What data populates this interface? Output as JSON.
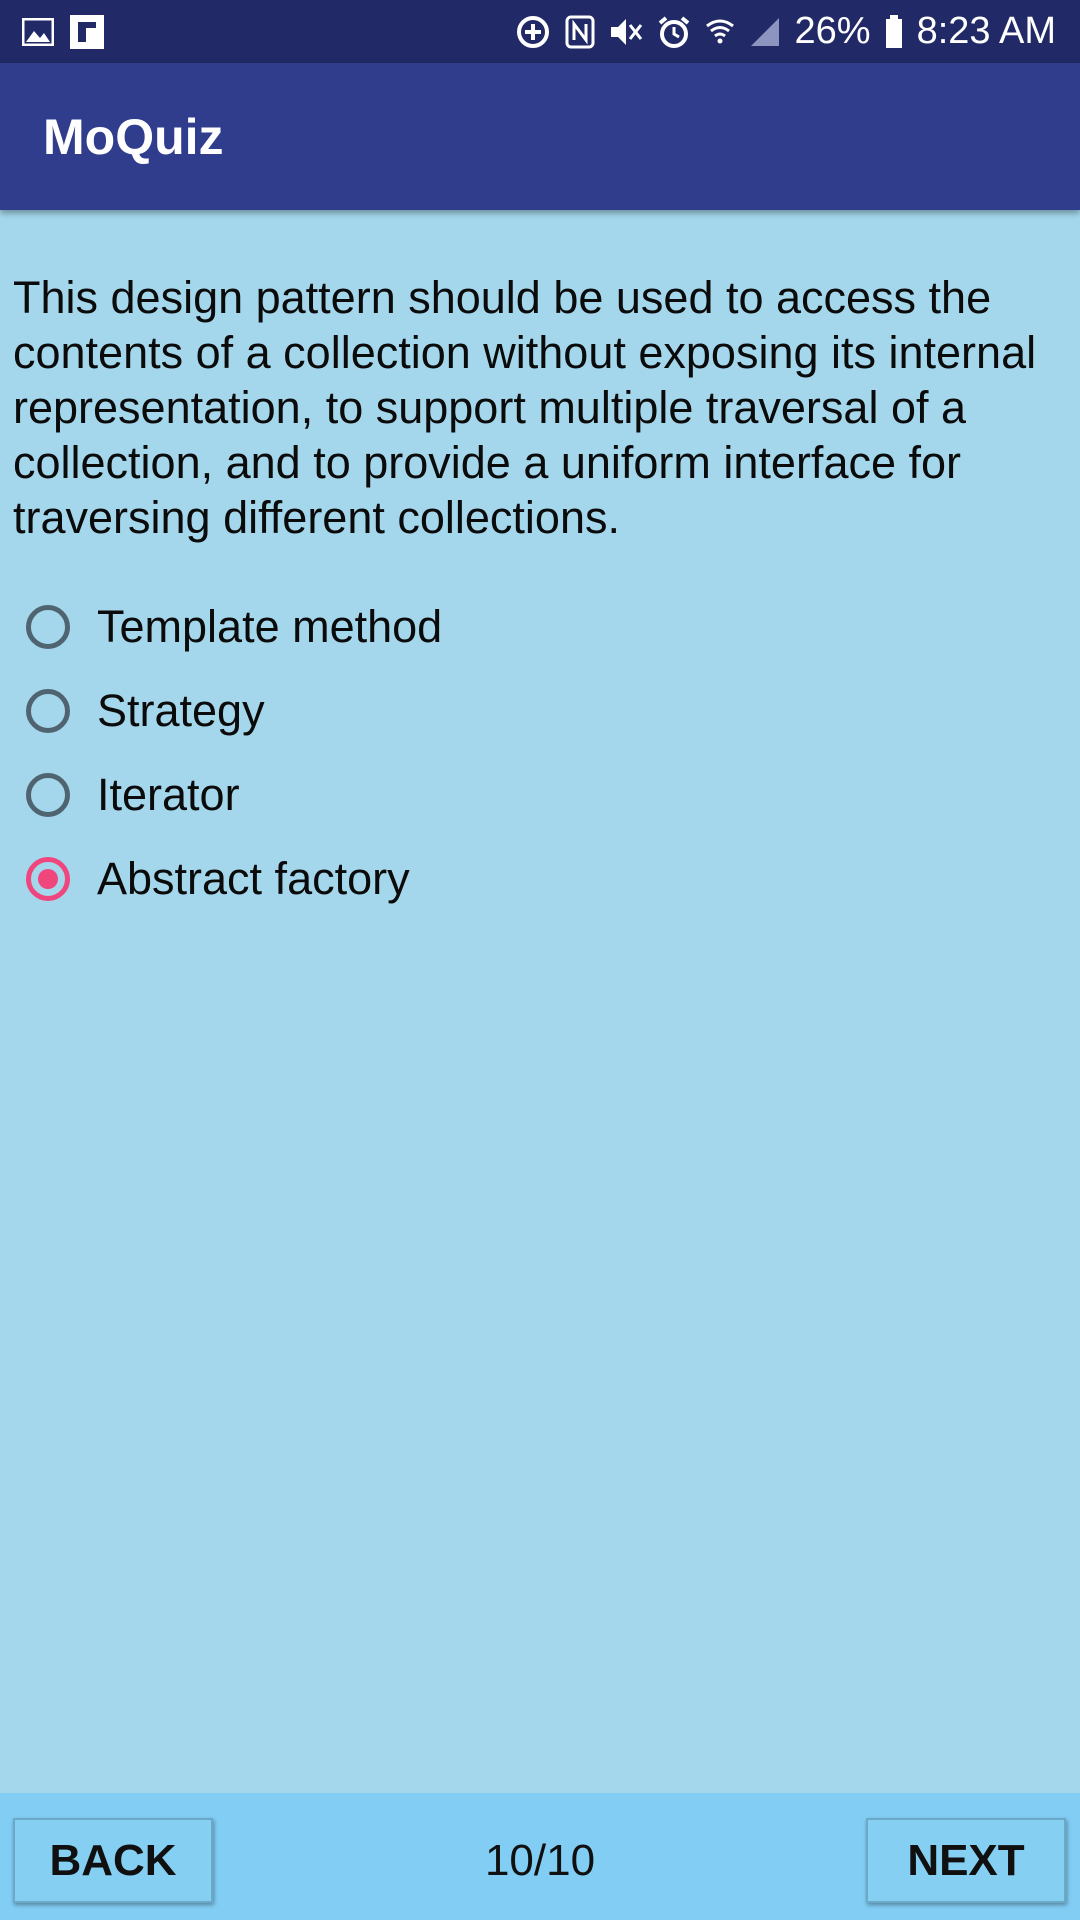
{
  "status_bar": {
    "left_icons": [
      "gallery-icon",
      "flipboard-icon"
    ],
    "right_icons": [
      "data-saver-icon",
      "nfc-icon",
      "mute-icon",
      "alarm-icon",
      "wifi-icon",
      "signal-icon",
      "battery-icon"
    ],
    "battery_percent": "26%",
    "time": "8:23 AM"
  },
  "app_bar": {
    "title": "MoQuiz"
  },
  "quiz": {
    "question": "This design pattern should be used to access the contents of a collection without exposing its internal representation, to support multiple traversal of a collection, and to provide a uniform interface for traversing different collections.",
    "options": [
      {
        "label": "Template method",
        "selected": false
      },
      {
        "label": "Strategy",
        "selected": false
      },
      {
        "label": "Iterator",
        "selected": false
      },
      {
        "label": "Abstract factory",
        "selected": true
      }
    ]
  },
  "navigation": {
    "back_label": "BACK",
    "next_label": "NEXT",
    "progress": "10/10"
  },
  "colors": {
    "status_bar": "#212a66",
    "app_bar": "#303c8c",
    "background": "#a5d7ec",
    "bottom_bar": "#82cdf4",
    "radio_selected": "#f0467e",
    "radio_unselected": "#4f6470"
  }
}
